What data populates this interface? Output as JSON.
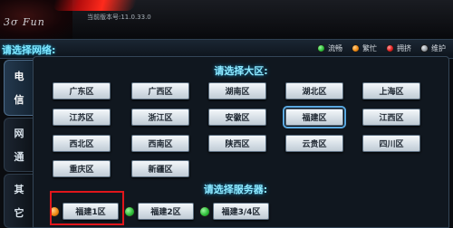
{
  "header": {
    "logo_signature": "3σ Fun",
    "version_text": "当前版本号:11.0.33.0"
  },
  "prompt": {
    "select_network": "请选择网络:"
  },
  "legend": [
    {
      "label": "流畅",
      "color": "#2fbf3a"
    },
    {
      "label": "繁忙",
      "color": "#f08a12"
    },
    {
      "label": "拥挤",
      "color": "#e02020"
    },
    {
      "label": "维护",
      "color": "#9aa0a6"
    }
  ],
  "tabs": [
    {
      "label": "电信",
      "chars": [
        "电",
        "信"
      ],
      "active": true
    },
    {
      "label": "网通",
      "chars": [
        "网",
        "通"
      ],
      "active": false
    },
    {
      "label": "其它",
      "chars": [
        "其",
        "它"
      ],
      "active": false
    }
  ],
  "region_title": "请选择大区:",
  "regions": [
    [
      "广东区",
      "广西区",
      "湖南区",
      "湖北区",
      "上海区"
    ],
    [
      "江苏区",
      "浙江区",
      "安徽区",
      "福建区",
      "江西区"
    ],
    [
      "西北区",
      "西南区",
      "陕西区",
      "云贵区",
      "四川区"
    ],
    [
      "重庆区",
      "新疆区"
    ]
  ],
  "selected_region": "福建区",
  "server_title": "请选择服务器:",
  "servers": [
    {
      "label": "福建1区",
      "status_color": "#f08a12"
    },
    {
      "label": "福建2区",
      "status_color": "#2fbf3a"
    },
    {
      "label": "福建3/4区",
      "status_color": "#2fbf3a"
    }
  ]
}
